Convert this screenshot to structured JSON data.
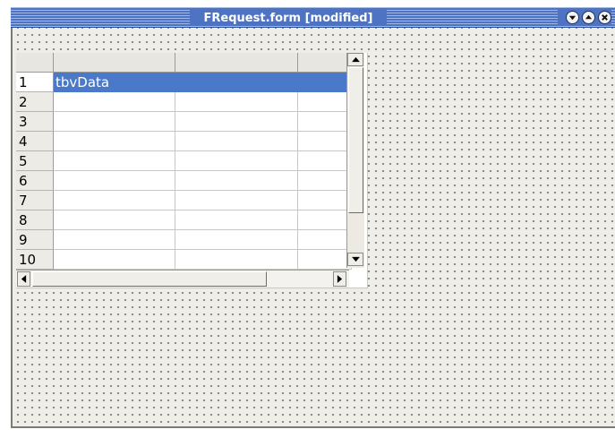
{
  "window": {
    "title": "FRequest.form [modified]",
    "controls": [
      {
        "icon": "minimize-icon"
      },
      {
        "icon": "maximize-icon"
      },
      {
        "icon": "close-icon"
      }
    ]
  },
  "table": {
    "name": "tbvData",
    "column_headers": [
      "",
      "",
      ""
    ],
    "rows": [
      {
        "num": "1",
        "cells": [
          "tbvData",
          "",
          ""
        ],
        "selected": true
      },
      {
        "num": "2",
        "cells": [
          "",
          "",
          ""
        ]
      },
      {
        "num": "3",
        "cells": [
          "",
          "",
          ""
        ]
      },
      {
        "num": "4",
        "cells": [
          "",
          "",
          ""
        ]
      },
      {
        "num": "5",
        "cells": [
          "",
          "",
          ""
        ]
      },
      {
        "num": "6",
        "cells": [
          "",
          "",
          ""
        ]
      },
      {
        "num": "7",
        "cells": [
          "",
          "",
          ""
        ]
      },
      {
        "num": "8",
        "cells": [
          "",
          "",
          ""
        ]
      },
      {
        "num": "9",
        "cells": [
          "",
          "",
          ""
        ]
      },
      {
        "num": "10",
        "cells": [
          "",
          "",
          ""
        ]
      }
    ]
  },
  "colors": {
    "titlebar": "#4d73c2",
    "selection": "#4b79c9",
    "canvas": "#eeede7"
  }
}
